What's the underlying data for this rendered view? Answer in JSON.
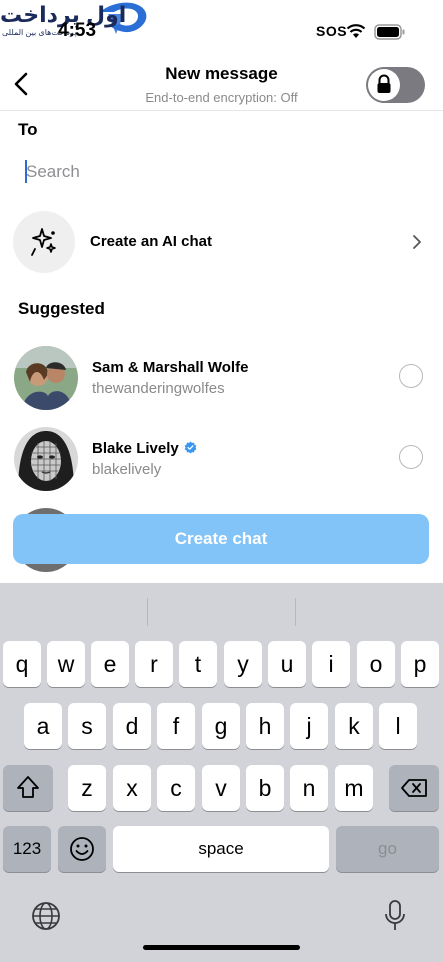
{
  "watermark": {
    "title": "اول پرداخت",
    "subtitle": "پرداخت‌های بین المللی"
  },
  "status_bar": {
    "time": "4:53",
    "signal_text": "SOS"
  },
  "header": {
    "title": "New message",
    "subtitle": "End-to-end encryption: Off",
    "encryption_enabled": false
  },
  "to_section": {
    "label": "To",
    "search_placeholder": "Search"
  },
  "ai_chat": {
    "label": "Create an AI chat"
  },
  "suggested": {
    "label": "Suggested",
    "contacts": [
      {
        "name": "Sam & Marshall Wolfe",
        "handle": "thewanderingwolfes",
        "verified": false
      },
      {
        "name": "Blake Lively",
        "handle": "blakelively",
        "verified": true
      }
    ]
  },
  "create_button": {
    "label": "Create chat"
  },
  "keyboard": {
    "row1": [
      "q",
      "w",
      "e",
      "r",
      "t",
      "y",
      "u",
      "i",
      "o",
      "p"
    ],
    "row2": [
      "a",
      "s",
      "d",
      "f",
      "g",
      "h",
      "j",
      "k",
      "l"
    ],
    "row3": [
      "z",
      "x",
      "c",
      "v",
      "b",
      "n",
      "m"
    ],
    "numbers_label": "123",
    "space_label": "space",
    "go_label": "go"
  },
  "colors": {
    "accent_button": "#82c3f8",
    "verified": "#3897f0",
    "keyboard_bg": "#d1d3d9"
  }
}
